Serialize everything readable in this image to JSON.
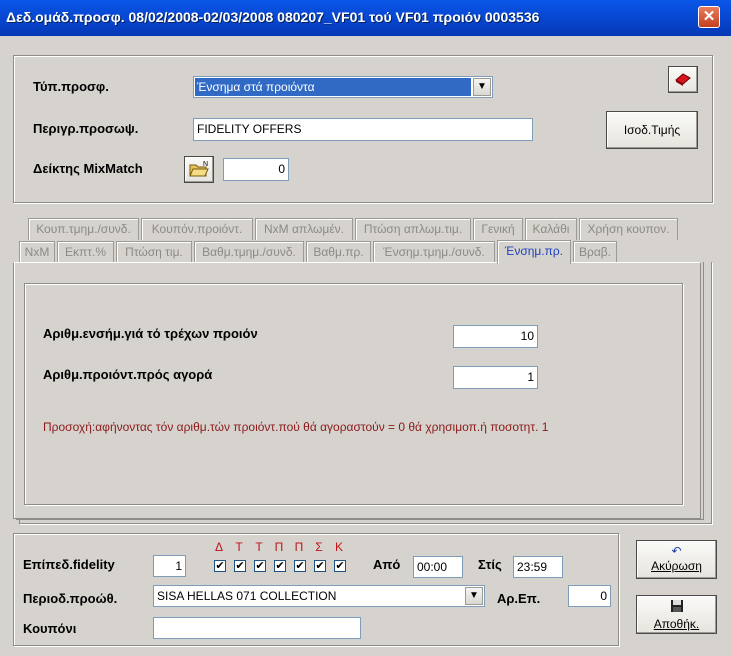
{
  "window": {
    "title": "Δεδ.ομάδ.προσφ. 08/02/2008-02/03/2008 080207_VF01 τού VF01 προιόν 0003536",
    "close": "✕"
  },
  "top": {
    "type_label": "Τύπ.προσφ.",
    "type_value": "Ένσημα στά προιόντα",
    "desc_label": "Περιγρ.προσωψ.",
    "desc_value": "FIDELITY OFFERS",
    "mixmatch_label": "Δείκτης MixMatch",
    "mixmatch_value": "0",
    "value_button": "Ισοδ.Τιμής",
    "folder_badge": "N"
  },
  "tabs_row1": [
    "Κουπ.τμημ./συνδ.",
    "Κουπόν.προιόντ.",
    "NxM απλωμέν.",
    "Πτώση απλωμ.τιμ.",
    "Γενική",
    "Καλάθι",
    "Χρήση κουπον."
  ],
  "tabs_row2": [
    "NxM",
    "Εκπτ.%",
    "Πτώση τιμ.",
    "Βαθμ.τμημ./συνδ.",
    "Βαθμ.πρ.",
    "Ένσημ.τμημ./συνδ.",
    "Ένσημ.πρ.",
    "Βραβ."
  ],
  "active_tab": "Ένσημ.πρ.",
  "panel": {
    "stamps_label": "Αριθμ.ενσήμ.γιά τό τρέχων προιόν",
    "stamps_value": "10",
    "buy_label": "Αριθμ.προιόντ.πρός αγορά",
    "buy_value": "1",
    "warning": "Προσοχή:αφήνοντας τόν αριθμ.τών προιόντ.πού θά αγοραστούν = 0 θά χρησιμοπ.ή ποσοτητ. 1"
  },
  "bottom": {
    "fidelity_label": "Επίπεδ.fidelity",
    "fidelity_value": "1",
    "days": [
      "Δ",
      "Τ",
      "Τ",
      "Π",
      "Π",
      "Σ",
      "Κ"
    ],
    "check_mark": "✔",
    "from_label": "Από",
    "from_value": "00:00",
    "to_label": "Στίς",
    "to_value": "23:59",
    "period_label": "Περιοδ.προώθ.",
    "period_value": "SISA HELLAS 071 COLLECTION",
    "ar_label": "Αρ.Επ.",
    "ar_value": "0",
    "coupon_label": "Κουπόνι",
    "coupon_value": ""
  },
  "buttons": {
    "cancel": "Ακύρωση",
    "save": "Αποθήκ.",
    "cancel_icon": "↶"
  },
  "colors": {
    "title_bar": "#0745cf",
    "active_tab_text": "#2040c0",
    "warning": "#8b1a1a",
    "day_letters": "#c0141a",
    "combo_highlight": "#316ac5"
  }
}
